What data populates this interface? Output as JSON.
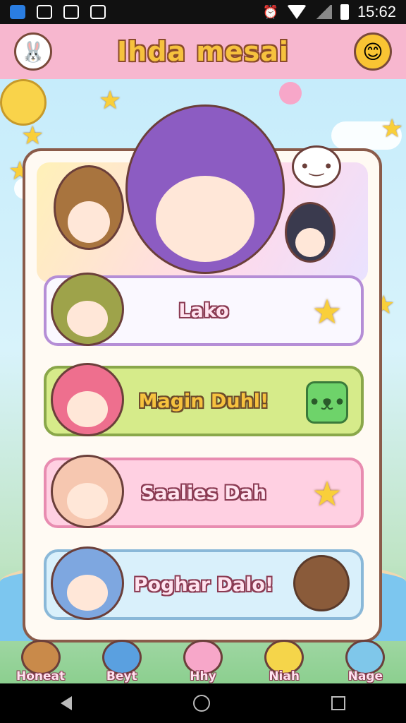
{
  "status_bar": {
    "time": "15:62"
  },
  "header": {
    "title": "Ihda mesai",
    "left_icon": "bunny-icon",
    "right_icon": "orange-fruit-icon"
  },
  "menu": [
    {
      "label": "Lako",
      "icon": "star-icon"
    },
    {
      "label": "Magin Duhl!",
      "icon": "green-cat-icon"
    },
    {
      "label": "Saalies Dah",
      "icon": "star-icon"
    },
    {
      "label": "Poghar Dalo!",
      "icon": "girl-avatar-icon"
    }
  ],
  "bottom_nav": [
    {
      "label": "Honeat",
      "icon": "bear-icon"
    },
    {
      "label": "Beyt",
      "icon": "brush-icon"
    },
    {
      "label": "Hhy",
      "icon": "lollipop-icon"
    },
    {
      "label": "Niah",
      "icon": "cat-icon"
    },
    {
      "label": "Nage",
      "icon": "blue-creature-icon"
    }
  ],
  "colors": {
    "header_bg": "#f7b7cf",
    "title": "#f6c23e",
    "btn1": "#faf8ff",
    "btn2": "#d6eb8a",
    "btn3": "#ffd0e2",
    "btn4": "#d9f0fb"
  }
}
